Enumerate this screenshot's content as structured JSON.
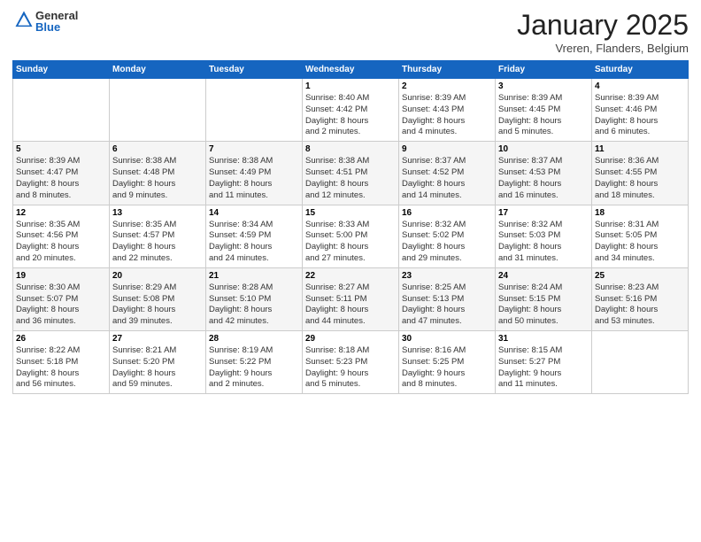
{
  "logo": {
    "general": "General",
    "blue": "Blue"
  },
  "title": "January 2025",
  "subtitle": "Vreren, Flanders, Belgium",
  "days_of_week": [
    "Sunday",
    "Monday",
    "Tuesday",
    "Wednesday",
    "Thursday",
    "Friday",
    "Saturday"
  ],
  "weeks": [
    [
      {
        "day": "",
        "info": ""
      },
      {
        "day": "",
        "info": ""
      },
      {
        "day": "",
        "info": ""
      },
      {
        "day": "1",
        "info": "Sunrise: 8:40 AM\nSunset: 4:42 PM\nDaylight: 8 hours\nand 2 minutes."
      },
      {
        "day": "2",
        "info": "Sunrise: 8:39 AM\nSunset: 4:43 PM\nDaylight: 8 hours\nand 4 minutes."
      },
      {
        "day": "3",
        "info": "Sunrise: 8:39 AM\nSunset: 4:45 PM\nDaylight: 8 hours\nand 5 minutes."
      },
      {
        "day": "4",
        "info": "Sunrise: 8:39 AM\nSunset: 4:46 PM\nDaylight: 8 hours\nand 6 minutes."
      }
    ],
    [
      {
        "day": "5",
        "info": "Sunrise: 8:39 AM\nSunset: 4:47 PM\nDaylight: 8 hours\nand 8 minutes."
      },
      {
        "day": "6",
        "info": "Sunrise: 8:38 AM\nSunset: 4:48 PM\nDaylight: 8 hours\nand 9 minutes."
      },
      {
        "day": "7",
        "info": "Sunrise: 8:38 AM\nSunset: 4:49 PM\nDaylight: 8 hours\nand 11 minutes."
      },
      {
        "day": "8",
        "info": "Sunrise: 8:38 AM\nSunset: 4:51 PM\nDaylight: 8 hours\nand 12 minutes."
      },
      {
        "day": "9",
        "info": "Sunrise: 8:37 AM\nSunset: 4:52 PM\nDaylight: 8 hours\nand 14 minutes."
      },
      {
        "day": "10",
        "info": "Sunrise: 8:37 AM\nSunset: 4:53 PM\nDaylight: 8 hours\nand 16 minutes."
      },
      {
        "day": "11",
        "info": "Sunrise: 8:36 AM\nSunset: 4:55 PM\nDaylight: 8 hours\nand 18 minutes."
      }
    ],
    [
      {
        "day": "12",
        "info": "Sunrise: 8:35 AM\nSunset: 4:56 PM\nDaylight: 8 hours\nand 20 minutes."
      },
      {
        "day": "13",
        "info": "Sunrise: 8:35 AM\nSunset: 4:57 PM\nDaylight: 8 hours\nand 22 minutes."
      },
      {
        "day": "14",
        "info": "Sunrise: 8:34 AM\nSunset: 4:59 PM\nDaylight: 8 hours\nand 24 minutes."
      },
      {
        "day": "15",
        "info": "Sunrise: 8:33 AM\nSunset: 5:00 PM\nDaylight: 8 hours\nand 27 minutes."
      },
      {
        "day": "16",
        "info": "Sunrise: 8:32 AM\nSunset: 5:02 PM\nDaylight: 8 hours\nand 29 minutes."
      },
      {
        "day": "17",
        "info": "Sunrise: 8:32 AM\nSunset: 5:03 PM\nDaylight: 8 hours\nand 31 minutes."
      },
      {
        "day": "18",
        "info": "Sunrise: 8:31 AM\nSunset: 5:05 PM\nDaylight: 8 hours\nand 34 minutes."
      }
    ],
    [
      {
        "day": "19",
        "info": "Sunrise: 8:30 AM\nSunset: 5:07 PM\nDaylight: 8 hours\nand 36 minutes."
      },
      {
        "day": "20",
        "info": "Sunrise: 8:29 AM\nSunset: 5:08 PM\nDaylight: 8 hours\nand 39 minutes."
      },
      {
        "day": "21",
        "info": "Sunrise: 8:28 AM\nSunset: 5:10 PM\nDaylight: 8 hours\nand 42 minutes."
      },
      {
        "day": "22",
        "info": "Sunrise: 8:27 AM\nSunset: 5:11 PM\nDaylight: 8 hours\nand 44 minutes."
      },
      {
        "day": "23",
        "info": "Sunrise: 8:25 AM\nSunset: 5:13 PM\nDaylight: 8 hours\nand 47 minutes."
      },
      {
        "day": "24",
        "info": "Sunrise: 8:24 AM\nSunset: 5:15 PM\nDaylight: 8 hours\nand 50 minutes."
      },
      {
        "day": "25",
        "info": "Sunrise: 8:23 AM\nSunset: 5:16 PM\nDaylight: 8 hours\nand 53 minutes."
      }
    ],
    [
      {
        "day": "26",
        "info": "Sunrise: 8:22 AM\nSunset: 5:18 PM\nDaylight: 8 hours\nand 56 minutes."
      },
      {
        "day": "27",
        "info": "Sunrise: 8:21 AM\nSunset: 5:20 PM\nDaylight: 8 hours\nand 59 minutes."
      },
      {
        "day": "28",
        "info": "Sunrise: 8:19 AM\nSunset: 5:22 PM\nDaylight: 9 hours\nand 2 minutes."
      },
      {
        "day": "29",
        "info": "Sunrise: 8:18 AM\nSunset: 5:23 PM\nDaylight: 9 hours\nand 5 minutes."
      },
      {
        "day": "30",
        "info": "Sunrise: 8:16 AM\nSunset: 5:25 PM\nDaylight: 9 hours\nand 8 minutes."
      },
      {
        "day": "31",
        "info": "Sunrise: 8:15 AM\nSunset: 5:27 PM\nDaylight: 9 hours\nand 11 minutes."
      },
      {
        "day": "",
        "info": ""
      }
    ]
  ],
  "colors": {
    "header_bg": "#1565c0",
    "header_text": "#ffffff",
    "border": "#cccccc",
    "even_row": "#f5f5f5"
  }
}
